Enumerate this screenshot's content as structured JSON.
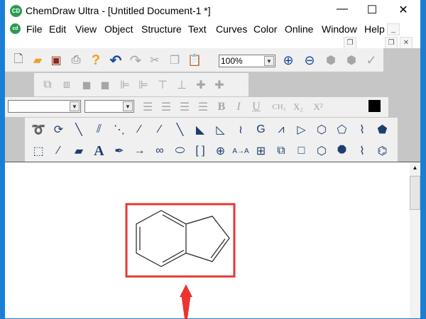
{
  "window": {
    "title": "ChemDraw Ultra - [Untitled Document-1 *]",
    "app_icon": "CD",
    "controls": {
      "minimize": "—",
      "maximize": "☐",
      "close": "✕"
    }
  },
  "menu": {
    "items": [
      "File",
      "Edit",
      "View",
      "Object",
      "Structure",
      "Text",
      "Curves",
      "Color",
      "Online",
      "Window",
      "Help"
    ],
    "mdi": {
      "minimize": "_",
      "restore": "❐",
      "close": "✕"
    }
  },
  "toolbar": {
    "zoom_value": "100%",
    "icons_row1": [
      "new-document",
      "open-folder",
      "save",
      "print",
      "help",
      "undo",
      "redo",
      "cut",
      "copy",
      "paste",
      "zoom-in",
      "zoom-out",
      "structure-clean",
      "structure-check",
      "checkmark"
    ]
  },
  "style_bar": {
    "font_value": "",
    "size_value": "",
    "bold": "B",
    "italic": "I",
    "underline": "U",
    "ch2": "CH₂",
    "subscript": "X₂",
    "superscript": "X²"
  },
  "tools": {
    "row1": [
      "lasso",
      "rotate",
      "single-bond",
      "double-bond",
      "dashed-bond",
      "hashed-bond",
      "hashed-wedge",
      "bold-bond",
      "wedge-bond",
      "hollow-wedge",
      "wavy-bond",
      "generic-group",
      "chain",
      "triangle",
      "cyclohexane",
      "cycloheptane",
      "cyclohexane-chair",
      "cyclopentadiene"
    ],
    "row2": [
      "marquee",
      "mass-fragmentation",
      "eraser",
      "text",
      "pen",
      "arrow",
      "orbital",
      "oval",
      "brackets",
      "charge",
      "reaction-mapping",
      "table",
      "templates",
      "square",
      "hexagon",
      "octagon",
      "chair",
      "benzene"
    ]
  },
  "annotation_color": "#e53935",
  "molecule": "indene"
}
